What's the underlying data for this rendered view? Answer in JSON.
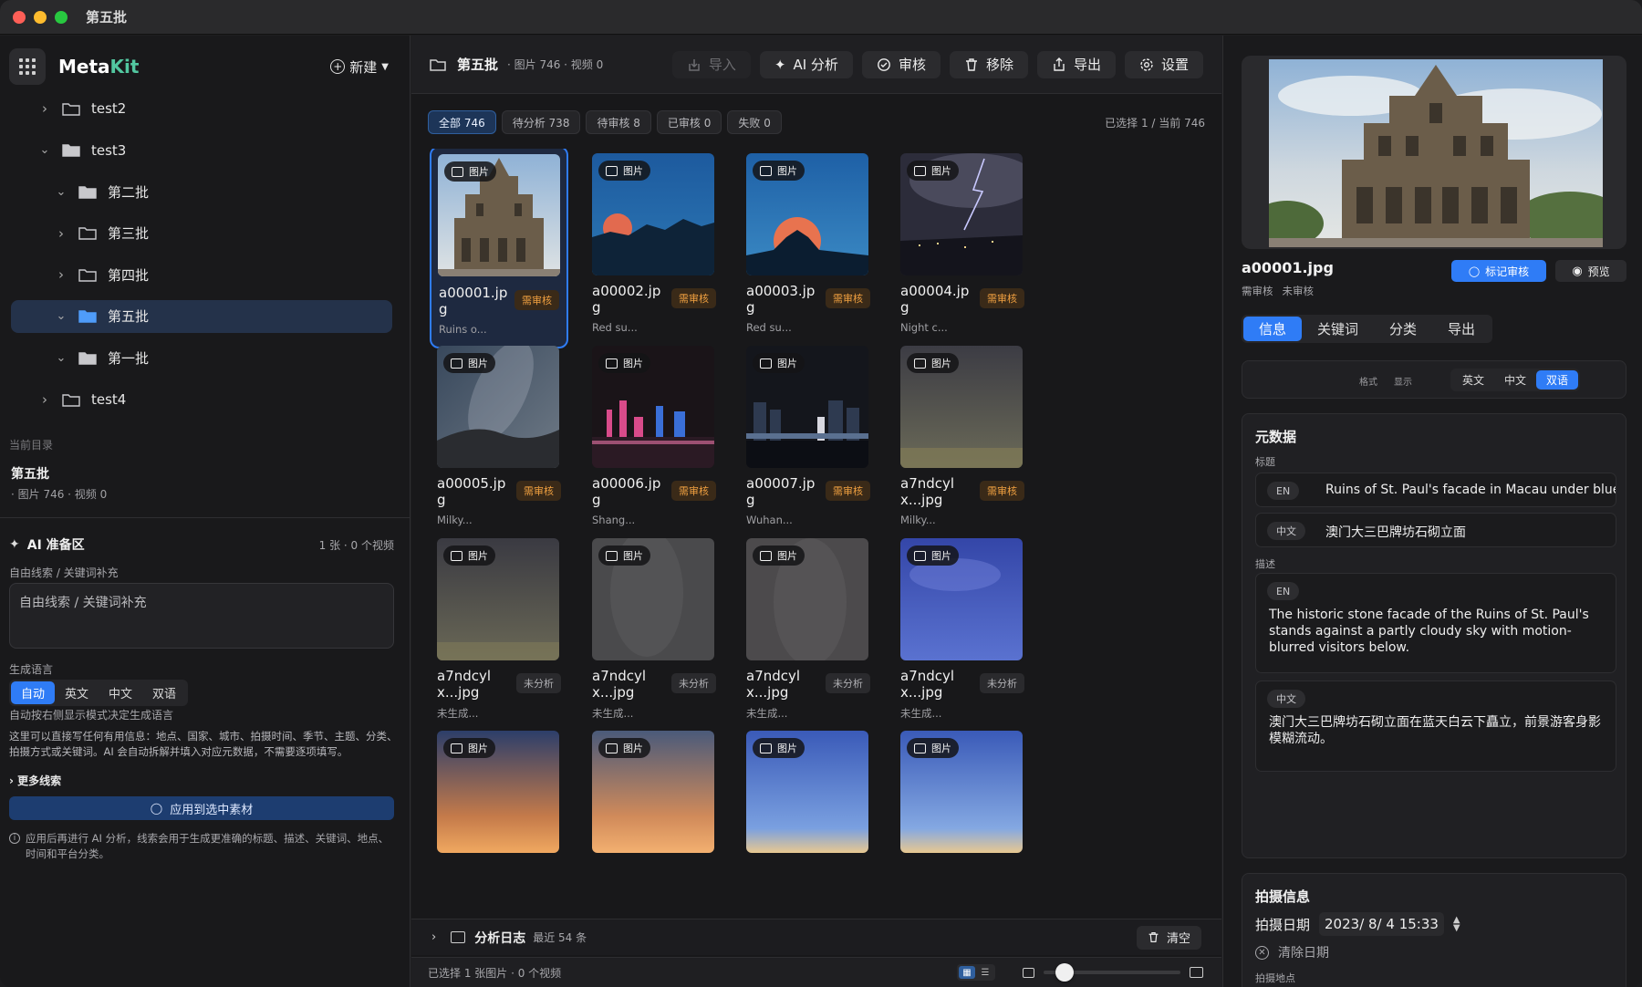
{
  "window": {
    "title": "第五批"
  },
  "sidebar": {
    "brand_meta": "Meta",
    "brand_kit": "Kit",
    "new_label": "新建",
    "tree": [
      {
        "label": "test2",
        "level": 0,
        "expanded": false
      },
      {
        "label": "test3",
        "level": 0,
        "expanded": true
      },
      {
        "label": "第二批",
        "level": 1,
        "expanded": true
      },
      {
        "label": "第三批",
        "level": 1,
        "expanded": false
      },
      {
        "label": "第四批",
        "level": 1,
        "expanded": false
      },
      {
        "label": "第五批",
        "level": 1,
        "expanded": true,
        "active": true
      },
      {
        "label": "第一批",
        "level": 1,
        "expanded": true
      },
      {
        "label": "test4",
        "level": 0,
        "expanded": false
      }
    ],
    "current_dir_label": "当前目录",
    "current_dir_name": "第五批",
    "current_dir_count": "· 图片 746 · 视频 0",
    "ai": {
      "title": "AI 准备区",
      "count": "1 张 · 0 个视频",
      "clue_label": "自由线索 / 关键词补充",
      "clue_placeholder": "自由线索 / 关键词补充",
      "lang_label": "生成语言",
      "lang_options": [
        "自动",
        "英文",
        "中文",
        "双语"
      ],
      "auto_hint": "自动按右侧显示模式决定生成语言",
      "desc": "这里可以直接写任何有用信息：地点、国家、城市、拍摄时间、季节、主题、分类、拍摄方式或关键词。AI 会自动拆解并填入对应元数据，不需要逐项填写。",
      "more_clues": "更多线索",
      "apply_label": "应用到选中素材",
      "apply_note": "应用后再进行 AI 分析，线索会用于生成更准确的标题、描述、关键词、地点、时间和平台分类。"
    }
  },
  "main": {
    "title": "第五批",
    "count": "· 图片 746 · 视频 0",
    "toolbar": {
      "import": "导入",
      "ai": "AI 分析",
      "review": "审核",
      "remove": "移除",
      "export": "导出",
      "settings": "设置"
    },
    "filters": [
      "全部 746",
      "待分析 738",
      "待审核 8",
      "已审核 0",
      "失败 0"
    ],
    "selection_info": "已选择 1 / 当前 746",
    "type_label": "图片",
    "cards": [
      {
        "name": "a00001.jpg",
        "desc": "Ruins o...",
        "status": "需审核",
        "kind": "review",
        "scene": "ruins"
      },
      {
        "name": "a00002.jpg",
        "desc": "Red su...",
        "status": "需审核",
        "kind": "review",
        "scene": "moon"
      },
      {
        "name": "a00003.jpg",
        "desc": "Red su...",
        "status": "需审核",
        "kind": "review",
        "scene": "moon2"
      },
      {
        "name": "a00004.jpg",
        "desc": "Night c...",
        "status": "需审核",
        "kind": "review",
        "scene": "lightning"
      },
      {
        "name": "a00005.jpg",
        "desc": "Milky...",
        "status": "需审核",
        "kind": "review",
        "scene": "milky"
      },
      {
        "name": "a00006.jpg",
        "desc": "Shang...",
        "status": "需审核",
        "kind": "review",
        "scene": "city"
      },
      {
        "name": "a00007.jpg",
        "desc": "Wuhan...",
        "status": "需审核",
        "kind": "review",
        "scene": "city2"
      },
      {
        "name": "a7ndcylx...jpg",
        "desc": "Milky...",
        "status": "需审核",
        "kind": "review",
        "scene": "stars"
      },
      {
        "name": "a7ndcylx...jpg",
        "desc": "未生成...",
        "status": "未分析",
        "kind": "none",
        "scene": "stars2"
      },
      {
        "name": "a7ndcylx...jpg",
        "desc": "未生成...",
        "status": "未分析",
        "kind": "none",
        "scene": "stars3"
      },
      {
        "name": "a7ndcylx...jpg",
        "desc": "未生成...",
        "status": "未分析",
        "kind": "none",
        "scene": "stars4"
      },
      {
        "name": "a7ndcylx...jpg",
        "desc": "未生成...",
        "status": "未分析",
        "kind": "none",
        "scene": "blue"
      },
      {
        "name": "",
        "desc": "",
        "status": "",
        "kind": "",
        "scene": "sunset"
      },
      {
        "name": "",
        "desc": "",
        "status": "",
        "kind": "",
        "scene": "sunset2"
      },
      {
        "name": "",
        "desc": "",
        "status": "",
        "kind": "",
        "scene": "dusk"
      },
      {
        "name": "",
        "desc": "",
        "status": "",
        "kind": "",
        "scene": "dusk2"
      }
    ],
    "log": {
      "title": "分析日志",
      "count": "最近 54 条",
      "clear": "清空"
    },
    "status_text": "已选择 1 张图片 · 0 个视频",
    "zoom_level": 0.1
  },
  "detail": {
    "file_name": "a00001.jpg",
    "sub_a": "需审核",
    "sub_b": "未审核",
    "mark_label": "标记审核",
    "preview_label": "预览",
    "tabs": [
      "信息",
      "关键词",
      "分类",
      "导出"
    ],
    "fmt_label": "格式",
    "display_label": "显示",
    "fmt_options": [
      "英文",
      "中文",
      "双语"
    ],
    "meta_title": "元数据",
    "title_label": "标题",
    "title_en": "Ruins of St. Paul's facade in Macau under blue",
    "title_zh": "澳门大三巴牌坊石砌立面",
    "desc_label": "描述",
    "desc_en": "The historic stone facade of the Ruins of St. Paul's stands against a partly cloudy sky with motion-blurred visitors below.",
    "desc_zh": "澳门大三巴牌坊石砌立面在蓝天白云下矗立，前景游客身影模糊流动。",
    "en_pill": "EN",
    "zh_pill": "中文",
    "shoot_title": "拍摄信息",
    "date_label": "拍摄日期",
    "date_value": "2023/  8/  4 15:33",
    "clear_date": "清除日期",
    "loc_label": "拍摄地点"
  }
}
